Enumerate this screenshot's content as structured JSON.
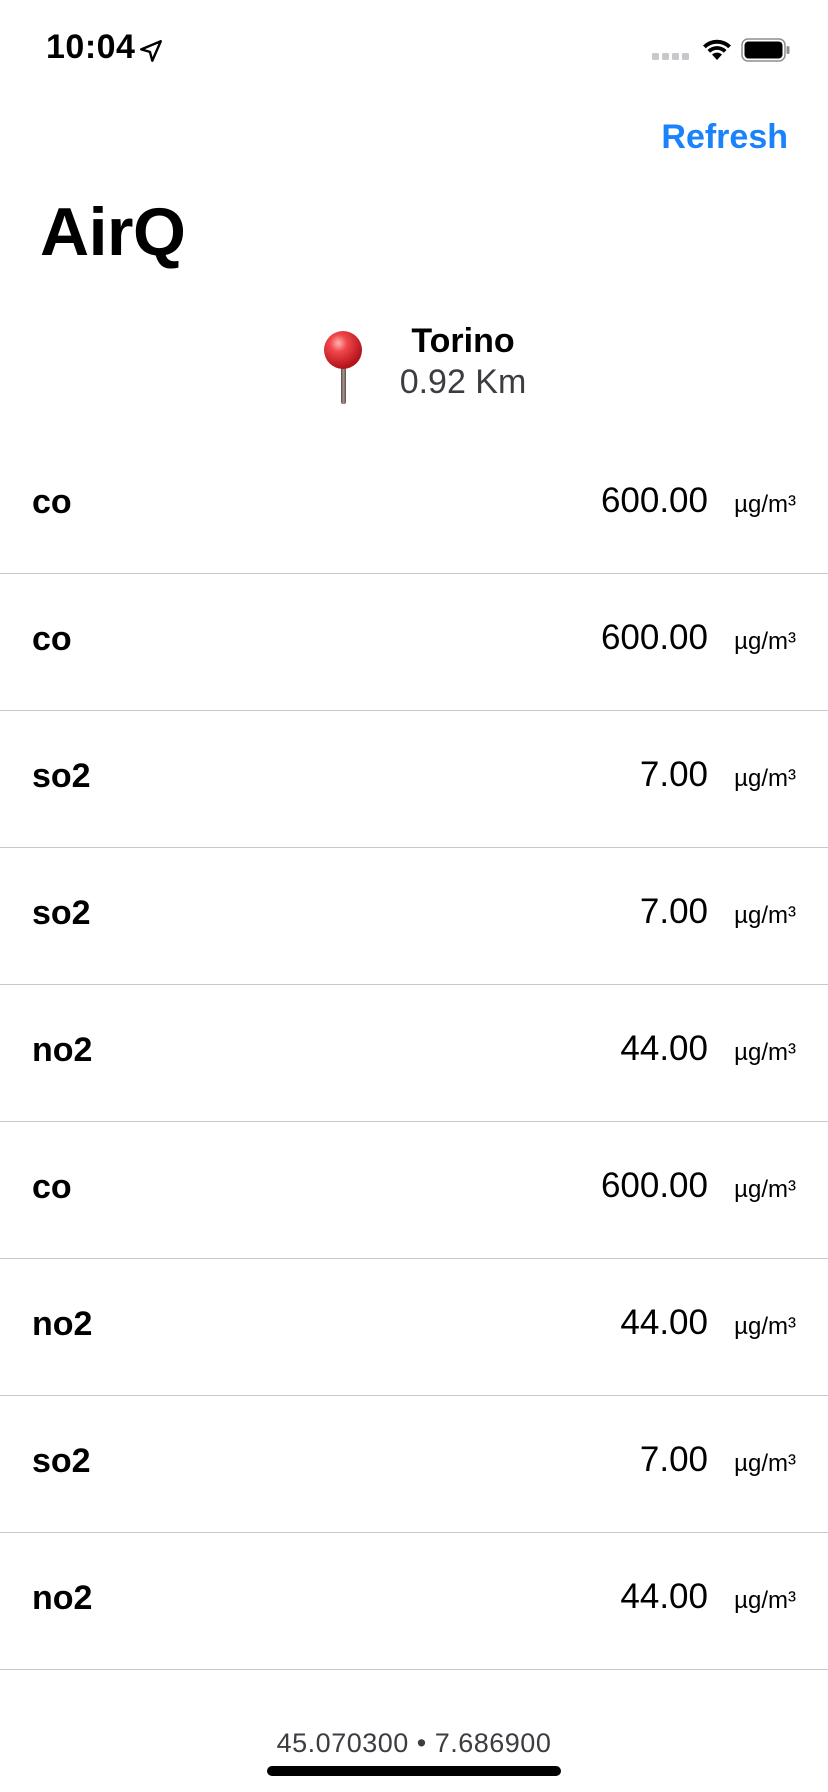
{
  "status_bar": {
    "time": "10:04",
    "location_icon": "location-arrow-icon",
    "signal_icon": "cellular-signal-icon",
    "wifi_icon": "wifi-icon",
    "battery_icon": "battery-icon"
  },
  "nav": {
    "refresh_label": "Refresh",
    "title": "AirQ"
  },
  "location": {
    "icon": "map-pin-icon",
    "city": "Torino",
    "distance": "0.92 Km"
  },
  "readings": [
    {
      "name": "co",
      "value": "600.00",
      "unit": "µg/m³"
    },
    {
      "name": "co",
      "value": "600.00",
      "unit": "µg/m³"
    },
    {
      "name": "so2",
      "value": "7.00",
      "unit": "µg/m³"
    },
    {
      "name": "so2",
      "value": "7.00",
      "unit": "µg/m³"
    },
    {
      "name": "no2",
      "value": "44.00",
      "unit": "µg/m³"
    },
    {
      "name": "co",
      "value": "600.00",
      "unit": "µg/m³"
    },
    {
      "name": "no2",
      "value": "44.00",
      "unit": "µg/m³"
    },
    {
      "name": "so2",
      "value": "7.00",
      "unit": "µg/m³"
    },
    {
      "name": "no2",
      "value": "44.00",
      "unit": "µg/m³"
    }
  ],
  "footer": {
    "coordinates": "45.070300 • 7.686900"
  },
  "colors": {
    "accent": "#1a82fb",
    "separator": "#c8c7cc",
    "pin_head": "#e0282e"
  }
}
